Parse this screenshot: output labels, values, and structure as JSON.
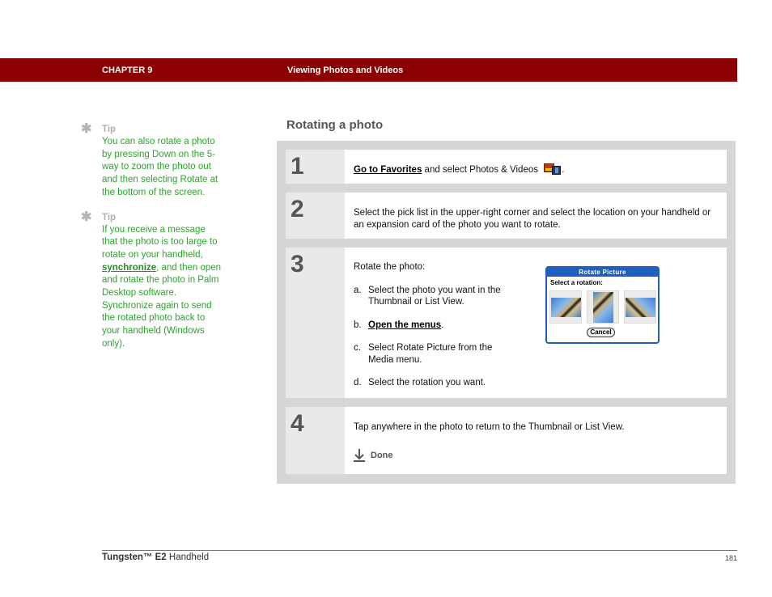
{
  "header": {
    "chapter": "CHAPTER 9",
    "title": "Viewing Photos and Videos",
    "bar_color": "#8b0000"
  },
  "tips": [
    {
      "icon": "asterisk-icon",
      "label": "Tip",
      "text": "You can also rotate a photo by pressing Down on the 5-way to zoom the photo out and then selecting Rotate at the bottom of the screen."
    },
    {
      "icon": "asterisk-icon",
      "label": "Tip",
      "text_before": "If you receive a message that the photo is too large to rotate on your handheld, ",
      "link": "synchronize",
      "text_after": ", and then open and rotate the photo in Palm Desktop software. Synchronize again to send the rotated photo back to your handheld (Windows only)."
    }
  ],
  "section": {
    "title": "Rotating a photo"
  },
  "steps": [
    {
      "number": "1",
      "link": "Go to Favorites",
      "text": " and select Photos & Videos",
      "icon": "photos-videos-icon",
      "text_end": "."
    },
    {
      "number": "2",
      "text": "Select the pick list in the upper-right corner and select the location on your handheld or an expansion card of the photo you want to rotate."
    },
    {
      "number": "3",
      "intro": "Rotate the photo:",
      "items": [
        {
          "letter": "a.",
          "text": "Select the photo you want in the Thumbnail or List View."
        },
        {
          "letter": "b.",
          "link": "Open the menus",
          "text_end": "."
        },
        {
          "letter": "c.",
          "text": "Select Rotate Picture from the Media menu."
        },
        {
          "letter": "d.",
          "text": "Select the rotation you want."
        }
      ],
      "dialog": {
        "title": "Rotate Picture",
        "prompt": "Select a rotation:",
        "options": [
          "rotate-left",
          "rotate-180",
          "rotate-right"
        ],
        "cancel": "Cancel"
      }
    },
    {
      "number": "4",
      "text": "Tap anywhere in the photo to return to the Thumbnail or List View.",
      "done_label": "Done"
    }
  ],
  "footer": {
    "product_name": "Tungsten™",
    "product_model": "E2",
    "product_suffix": "Handheld",
    "page_number": "181"
  }
}
